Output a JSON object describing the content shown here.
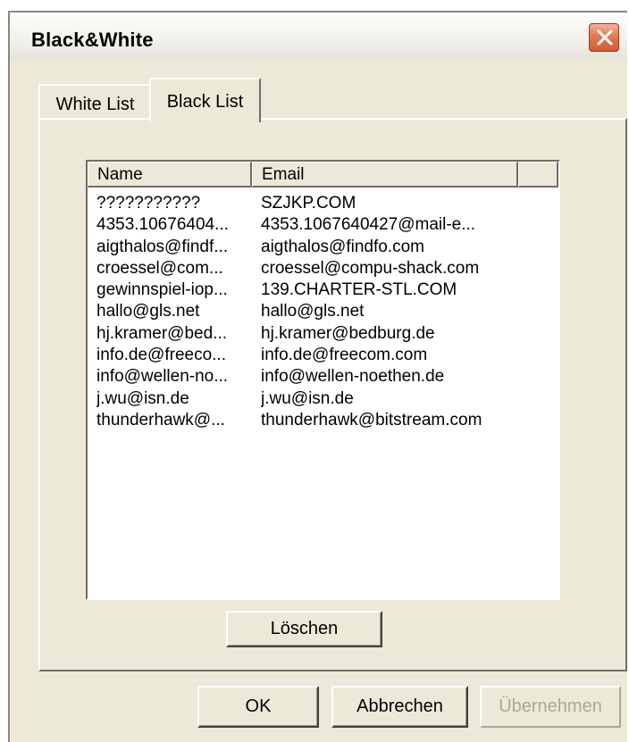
{
  "window": {
    "title": "Black&White",
    "close_icon": "close-x-icon",
    "colors": {
      "face": "#ece9d8",
      "close": "#e07a55",
      "disabled_text": "#aca899"
    }
  },
  "tabs": [
    {
      "label": "White List",
      "active": false
    },
    {
      "label": "Black List",
      "active": true
    }
  ],
  "list": {
    "columns": [
      "Name",
      "Email"
    ],
    "rows": [
      {
        "name": "???????????",
        "email": "SZJKP.COM"
      },
      {
        "name": "4353.10676404...",
        "email": "4353.1067640427@mail-e..."
      },
      {
        "name": "aigthalos@findf...",
        "email": "aigthalos@findfo.com"
      },
      {
        "name": "croessel@com...",
        "email": "croessel@compu-shack.com"
      },
      {
        "name": "gewinnspiel-iop...",
        "email": "139.CHARTER-STL.COM"
      },
      {
        "name": "hallo@gls.net",
        "email": "hallo@gls.net"
      },
      {
        "name": "hj.kramer@bed...",
        "email": "hj.kramer@bedburg.de"
      },
      {
        "name": "info.de@freeco...",
        "email": "info.de@freecom.com"
      },
      {
        "name": "info@wellen-no...",
        "email": "info@wellen-noethen.de"
      },
      {
        "name": "j.wu@isn.de",
        "email": "j.wu@isn.de"
      },
      {
        "name": "thunderhawk@...",
        "email": "thunderhawk@bitstream.com"
      }
    ]
  },
  "buttons": {
    "delete": "Löschen",
    "ok": "OK",
    "cancel": "Abbrechen",
    "apply": "Übernehmen",
    "apply_enabled": false
  }
}
